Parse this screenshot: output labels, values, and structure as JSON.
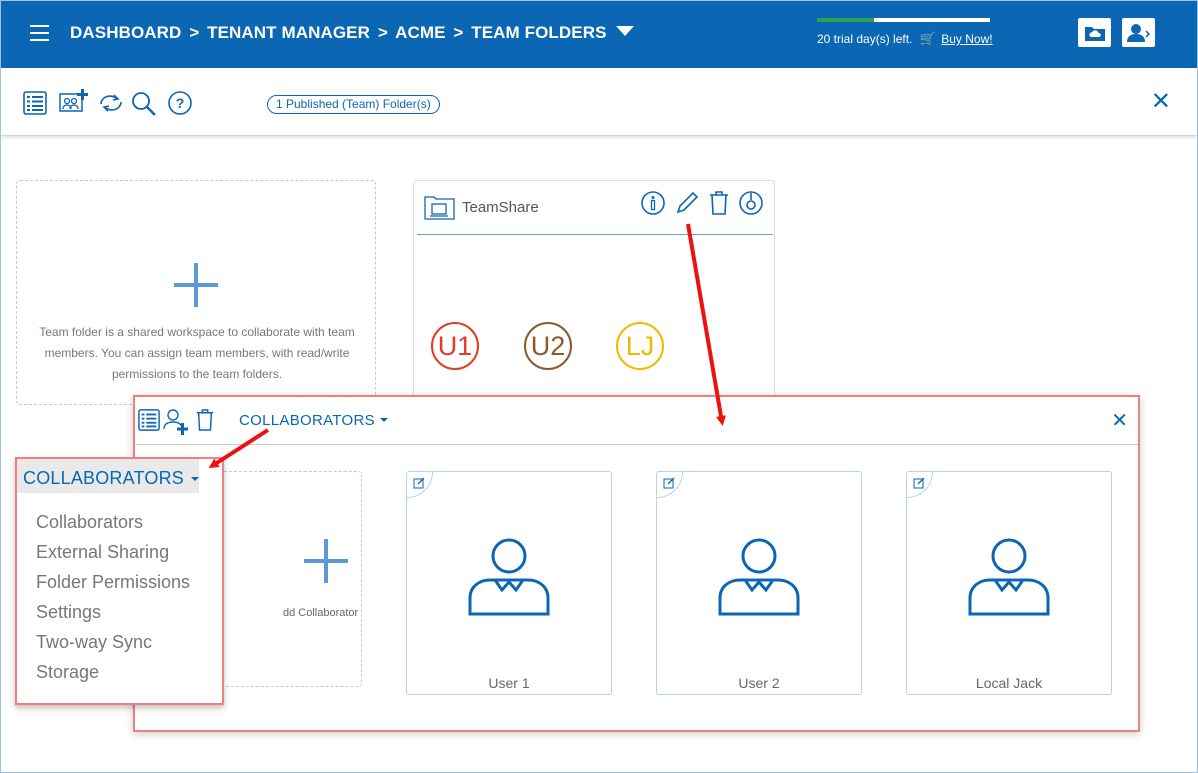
{
  "header": {
    "breadcrumb": [
      "DASHBOARD",
      "TENANT MANAGER",
      "ACME",
      "TEAM FOLDERS"
    ],
    "separator": ">",
    "trial_text": "20 trial day(s) left.",
    "trial_progress": 0.33,
    "buy_now": "Buy Now!",
    "colors": {
      "bar": "#0b66b3",
      "progress": "#2e9e54"
    }
  },
  "toolbar": {
    "published_pill": "1 Published (Team) Folder(s)",
    "icons": [
      "list-view-icon",
      "add-team-folder-icon",
      "sync-icon",
      "search-icon",
      "help-icon"
    ]
  },
  "new_folder_card": {
    "description": "Team folder is a shared workspace to collaborate with team members. You can assign team members, with read/write permissions to the team folders."
  },
  "folder_card": {
    "name": "TeamShare",
    "avatars": [
      {
        "initials": "U1",
        "color": "#e63a24"
      },
      {
        "initials": "U2",
        "color": "#8a5a2b"
      },
      {
        "initials": "LJ",
        "color": "#f3b700"
      }
    ]
  },
  "collab_panel": {
    "title": "COLLABORATORS",
    "add_label": "dd Collaborator",
    "users": [
      {
        "name": "User 1"
      },
      {
        "name": "User 2"
      },
      {
        "name": "Local Jack"
      }
    ]
  },
  "dropdown": {
    "title": "COLLABORATORS",
    "items": [
      "Collaborators",
      "External Sharing",
      "Folder Permissions",
      "Settings",
      "Two-way Sync",
      "Storage"
    ]
  }
}
